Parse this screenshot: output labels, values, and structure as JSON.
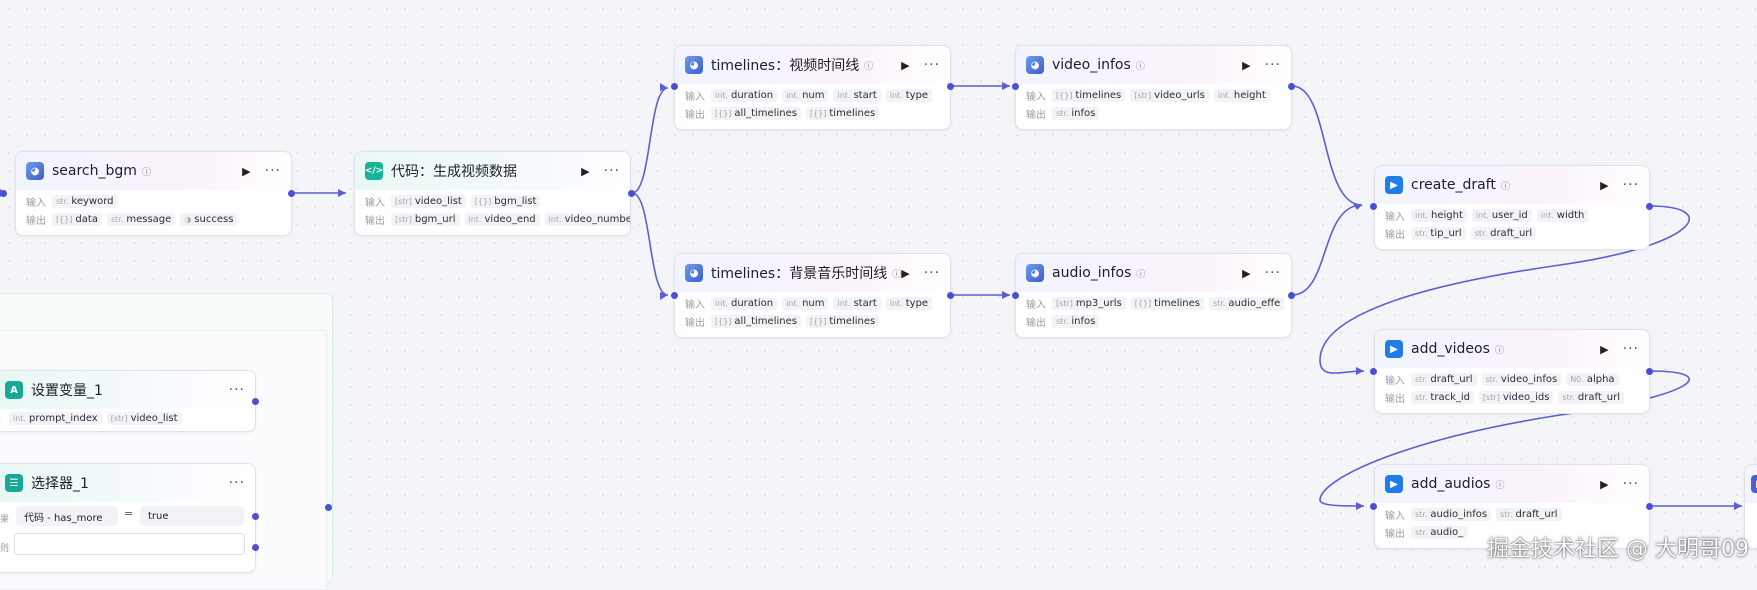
{
  "labels": {
    "in": "输入",
    "out": "输出",
    "run": "▶",
    "more": "···",
    "badge": "ⓘ"
  },
  "nodes": {
    "search_bgm": {
      "title": "search_bgm",
      "inputs": [
        {
          "t": "str.",
          "n": "keyword"
        }
      ],
      "outputs": [
        {
          "t": "[{}]",
          "n": "data"
        },
        {
          "t": "str.",
          "n": "message"
        },
        {
          "t": "◑",
          "n": "success"
        }
      ]
    },
    "code": {
      "title": "代码：生成视频数据",
      "inputs": [
        {
          "t": "[str]",
          "n": "video_list"
        },
        {
          "t": "[{}]",
          "n": "bgm_list"
        }
      ],
      "outputs": [
        {
          "t": "[str]",
          "n": "bgm_url"
        },
        {
          "t": "int.",
          "n": "video_end"
        },
        {
          "t": "int.",
          "n": "video_number"
        }
      ]
    },
    "timelines_video": {
      "title": "timelines：视频时间线",
      "inputs": [
        {
          "t": "int.",
          "n": "duration"
        },
        {
          "t": "int.",
          "n": "num"
        },
        {
          "t": "int.",
          "n": "start"
        },
        {
          "t": "int.",
          "n": "type"
        }
      ],
      "outputs": [
        {
          "t": "[{}]",
          "n": "all_timelines"
        },
        {
          "t": "[{}]",
          "n": "timelines"
        }
      ]
    },
    "video_infos": {
      "title": "video_infos",
      "inputs": [
        {
          "t": "[{}]",
          "n": "timelines"
        },
        {
          "t": "[str]",
          "n": "video_urls"
        },
        {
          "t": "int.",
          "n": "height"
        }
      ],
      "outputs": [
        {
          "t": "str.",
          "n": "infos"
        }
      ]
    },
    "timelines_bgm": {
      "title": "timelines：背景音乐时间线",
      "inputs": [
        {
          "t": "int.",
          "n": "duration"
        },
        {
          "t": "int.",
          "n": "num"
        },
        {
          "t": "int.",
          "n": "start"
        },
        {
          "t": "int.",
          "n": "type"
        }
      ],
      "outputs": [
        {
          "t": "[{}]",
          "n": "all_timelines"
        },
        {
          "t": "[{}]",
          "n": "timelines"
        }
      ]
    },
    "audio_infos": {
      "title": "audio_infos",
      "inputs": [
        {
          "t": "[str]",
          "n": "mp3_urls"
        },
        {
          "t": "[{}]",
          "n": "timelines"
        },
        {
          "t": "str.",
          "n": "audio_effe"
        }
      ],
      "outputs": [
        {
          "t": "str.",
          "n": "infos"
        }
      ]
    },
    "create_draft": {
      "title": "create_draft",
      "inputs": [
        {
          "t": "int.",
          "n": "height"
        },
        {
          "t": "int.",
          "n": "user_id"
        },
        {
          "t": "int.",
          "n": "width"
        }
      ],
      "outputs": [
        {
          "t": "str.",
          "n": "tip_url"
        },
        {
          "t": "str.",
          "n": "draft_url"
        }
      ]
    },
    "add_videos": {
      "title": "add_videos",
      "inputs": [
        {
          "t": "str.",
          "n": "draft_url"
        },
        {
          "t": "str.",
          "n": "video_infos"
        },
        {
          "t": "N0.",
          "n": "alpha"
        }
      ],
      "outputs": [
        {
          "t": "str.",
          "n": "track_id"
        },
        {
          "t": "[str]",
          "n": "video_ids"
        },
        {
          "t": "str.",
          "n": "draft_url"
        }
      ]
    },
    "add_audios": {
      "title": "add_audios",
      "inputs": [
        {
          "t": "str.",
          "n": "audio_infos"
        },
        {
          "t": "str.",
          "n": "draft_url"
        }
      ],
      "outputs": [
        {
          "t": "str.",
          "n": "audio_"
        }
      ]
    },
    "set_var": {
      "title": "设置变量_1",
      "side": "置",
      "inputs": [
        {
          "t": "int.",
          "n": "prompt_index"
        },
        {
          "t": "[str]",
          "n": "video_list"
        }
      ]
    },
    "selector": {
      "title": "选择器_1",
      "side1": "果",
      "side2": "则",
      "cond_left": "代码  -  has_more",
      "cond_op": "=",
      "cond_right": "true"
    }
  },
  "watermark": "掘金技术社区 @ 大明哥09"
}
